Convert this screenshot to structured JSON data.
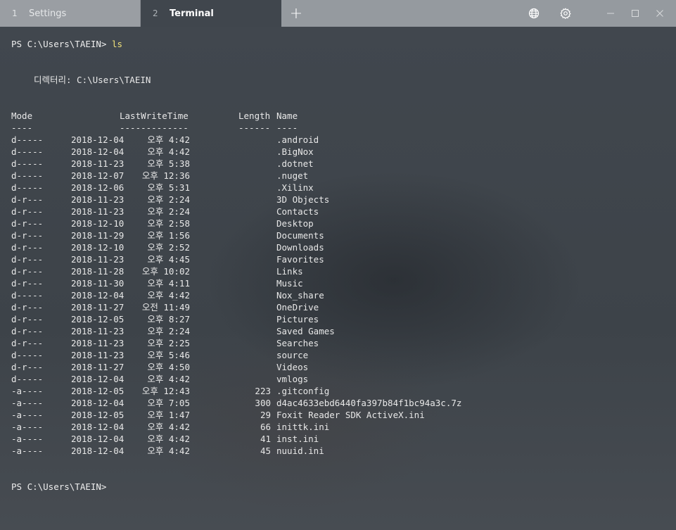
{
  "tabs": [
    {
      "number": "1",
      "label": "Settings"
    },
    {
      "number": "2",
      "label": "Terminal"
    }
  ],
  "titlebar": {
    "new_tab": "+",
    "icons": [
      "globe-icon",
      "gear-icon",
      "minimize-icon",
      "maximize-icon",
      "close-icon"
    ]
  },
  "terminal": {
    "prompt1": "PS C:\\Users\\TAEIN>",
    "command1": " ls",
    "directory_line": "디렉터리: C:\\Users\\TAEIN",
    "headers": {
      "mode": "Mode",
      "lastwritetime": "LastWriteTime",
      "length": "Length",
      "name": "Name"
    },
    "separators": {
      "mode": "----",
      "lastwritetime": "-------------",
      "length": "------",
      "name": "----"
    },
    "rows": [
      {
        "mode": "d-----",
        "date": "2018-12-04",
        "time": "오후 4:42",
        "length": "",
        "name": ".android"
      },
      {
        "mode": "d-----",
        "date": "2018-12-04",
        "time": "오후 4:42",
        "length": "",
        "name": ".BigNox"
      },
      {
        "mode": "d-----",
        "date": "2018-11-23",
        "time": "오후 5:38",
        "length": "",
        "name": ".dotnet"
      },
      {
        "mode": "d-----",
        "date": "2018-12-07",
        "time": "오후 12:36",
        "length": "",
        "name": ".nuget"
      },
      {
        "mode": "d-----",
        "date": "2018-12-06",
        "time": "오후 5:31",
        "length": "",
        "name": ".Xilinx"
      },
      {
        "mode": "d-r---",
        "date": "2018-11-23",
        "time": "오후 2:24",
        "length": "",
        "name": "3D Objects"
      },
      {
        "mode": "d-r---",
        "date": "2018-11-23",
        "time": "오후 2:24",
        "length": "",
        "name": "Contacts"
      },
      {
        "mode": "d-r---",
        "date": "2018-12-10",
        "time": "오후 2:58",
        "length": "",
        "name": "Desktop"
      },
      {
        "mode": "d-r---",
        "date": "2018-11-29",
        "time": "오후 1:56",
        "length": "",
        "name": "Documents"
      },
      {
        "mode": "d-r---",
        "date": "2018-12-10",
        "time": "오후 2:52",
        "length": "",
        "name": "Downloads"
      },
      {
        "mode": "d-r---",
        "date": "2018-11-23",
        "time": "오후 4:45",
        "length": "",
        "name": "Favorites"
      },
      {
        "mode": "d-r---",
        "date": "2018-11-28",
        "time": "오후 10:02",
        "length": "",
        "name": "Links"
      },
      {
        "mode": "d-r---",
        "date": "2018-11-30",
        "time": "오후 4:11",
        "length": "",
        "name": "Music"
      },
      {
        "mode": "d-----",
        "date": "2018-12-04",
        "time": "오후 4:42",
        "length": "",
        "name": "Nox_share"
      },
      {
        "mode": "d-r---",
        "date": "2018-11-27",
        "time": "오전 11:49",
        "length": "",
        "name": "OneDrive"
      },
      {
        "mode": "d-r---",
        "date": "2018-12-05",
        "time": "오후 8:27",
        "length": "",
        "name": "Pictures"
      },
      {
        "mode": "d-r---",
        "date": "2018-11-23",
        "time": "오후 2:24",
        "length": "",
        "name": "Saved Games"
      },
      {
        "mode": "d-r---",
        "date": "2018-11-23",
        "time": "오후 2:25",
        "length": "",
        "name": "Searches"
      },
      {
        "mode": "d-----",
        "date": "2018-11-23",
        "time": "오후 5:46",
        "length": "",
        "name": "source"
      },
      {
        "mode": "d-r---",
        "date": "2018-11-27",
        "time": "오후 4:50",
        "length": "",
        "name": "Videos"
      },
      {
        "mode": "d-----",
        "date": "2018-12-04",
        "time": "오후 4:42",
        "length": "",
        "name": "vmlogs"
      },
      {
        "mode": "-a----",
        "date": "2018-12-05",
        "time": "오후 12:43",
        "length": "223",
        "name": ".gitconfig"
      },
      {
        "mode": "-a----",
        "date": "2018-12-04",
        "time": "오후 7:05",
        "length": "300",
        "name": "d4ac4633ebd6440fa397b84f1bc94a3c.7z"
      },
      {
        "mode": "-a----",
        "date": "2018-12-05",
        "time": "오후 1:47",
        "length": "29",
        "name": "Foxit Reader SDK ActiveX.ini"
      },
      {
        "mode": "-a----",
        "date": "2018-12-04",
        "time": "오후 4:42",
        "length": "66",
        "name": "inittk.ini"
      },
      {
        "mode": "-a----",
        "date": "2018-12-04",
        "time": "오후 4:42",
        "length": "41",
        "name": "inst.ini"
      },
      {
        "mode": "-a----",
        "date": "2018-12-04",
        "time": "오후 4:42",
        "length": "45",
        "name": "nuuid.ini"
      }
    ],
    "prompt2": "PS C:\\Users\\TAEIN>"
  },
  "colors": {
    "titlebar": "#959a9f",
    "active_tab": "#40464d",
    "terminal_bg": "#3f454c",
    "command_text": "#f1e27a"
  }
}
